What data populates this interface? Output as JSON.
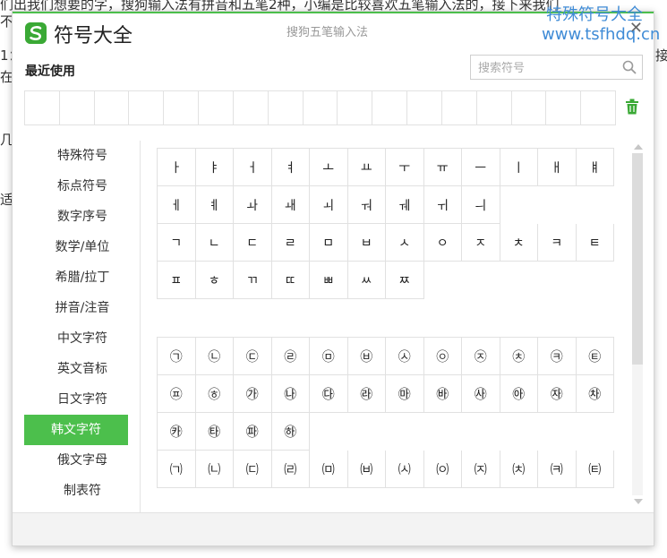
{
  "background": {
    "lines": [
      "们出我们想要的字，搜狗输入法有拼音和五笔2种，小编是比较喜欢五笔输入法的，接下来我们",
      "不",
      "1：",
      "在",
      "几",
      "适"
    ],
    "right_fragment": "接",
    "watermark_title": "特殊符号大全",
    "watermark_url": "www.tsfhdq.cn"
  },
  "window": {
    "app_title": "符号大全",
    "im_title": "搜狗五笔输入法",
    "close_label": "✕",
    "recent_label": "最近使用",
    "search_placeholder": "搜索符号",
    "accent_color": "#4cbf4c"
  },
  "sidebar": {
    "items": [
      {
        "label": "特殊符号"
      },
      {
        "label": "标点符号"
      },
      {
        "label": "数字序号"
      },
      {
        "label": "数学/单位"
      },
      {
        "label": "希腊/拉丁"
      },
      {
        "label": "拼音/注音"
      },
      {
        "label": "中文字符"
      },
      {
        "label": "英文音标"
      },
      {
        "label": "日文字符"
      },
      {
        "label": "韩文字符",
        "active": true
      },
      {
        "label": "俄文字母"
      },
      {
        "label": "制表符"
      }
    ]
  },
  "symbols": {
    "group1": [
      "ㅏ",
      "ㅑ",
      "ㅓ",
      "ㅕ",
      "ㅗ",
      "ㅛ",
      "ㅜ",
      "ㅠ",
      "ㅡ",
      "ㅣ",
      "ㅐ",
      "ㅒ",
      "ㅔ",
      "ㅖ",
      "ㅘ",
      "ㅙ",
      "ㅚ",
      "ㅝ",
      "ㅞ",
      "ㅟ",
      "ㅢ",
      "",
      "",
      "",
      "ㄱ",
      "ㄴ",
      "ㄷ",
      "ㄹ",
      "ㅁ",
      "ㅂ",
      "ㅅ",
      "ㅇ",
      "ㅈ",
      "ㅊ",
      "ㅋ",
      "ㅌ",
      "ㅍ",
      "ㅎ",
      "ㄲ",
      "ㄸ",
      "ㅃ",
      "ㅆ",
      "ㅉ"
    ],
    "group2": [
      "㉠",
      "㉡",
      "㉢",
      "㉣",
      "㉤",
      "㉥",
      "㉦",
      "㉧",
      "㉨",
      "㉩",
      "㉪",
      "㉫",
      "㉬",
      "㉭",
      "㉮",
      "㉯",
      "㉰",
      "㉱",
      "㉲",
      "㉳",
      "㉴",
      "㉵",
      "㉶",
      "㉷",
      "㉸",
      "㉹",
      "㉺",
      "㉻"
    ],
    "group3": [
      "㈀",
      "㈁",
      "㈂",
      "㈃",
      "㈄",
      "㈅",
      "㈆",
      "㈇",
      "㈈",
      "㈉",
      "㈊",
      "㈋"
    ]
  }
}
